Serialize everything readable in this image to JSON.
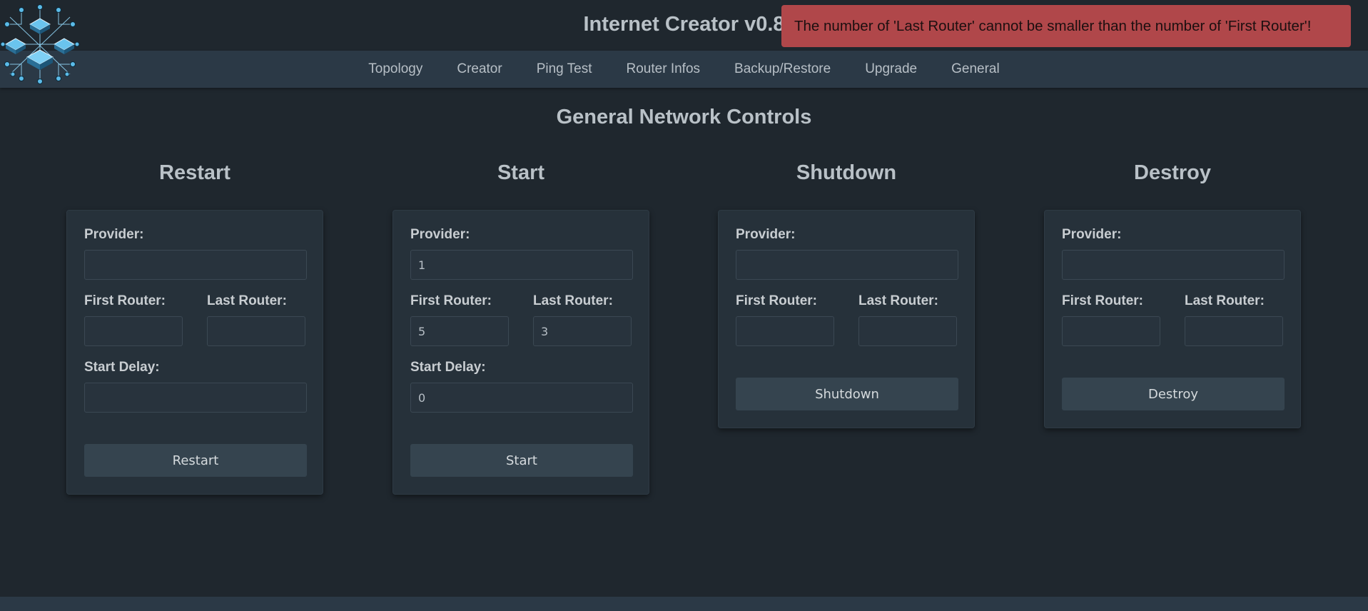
{
  "app": {
    "title": "Internet Creator v0.8"
  },
  "toast": {
    "message": "The number of 'Last Router' cannot be smaller than the number of 'First Router'!"
  },
  "nav": {
    "items": [
      "Topology",
      "Creator",
      "Ping Test",
      "Router Infos",
      "Backup/Restore",
      "Upgrade",
      "General"
    ]
  },
  "page": {
    "title": "General Network Controls"
  },
  "colors": {
    "background": "#1f272e",
    "navbar": "#2b3946",
    "card": "#26313a",
    "toast": "#b0474a",
    "button": "#35444f"
  },
  "labels": {
    "provider": "Provider:",
    "first_router": "First Router:",
    "last_router": "Last Router:",
    "start_delay": "Start Delay:"
  },
  "sections": {
    "restart": {
      "title": "Restart",
      "provider": "",
      "first_router": "",
      "last_router": "",
      "start_delay": "",
      "button": "Restart"
    },
    "start": {
      "title": "Start",
      "provider": "1",
      "first_router": "5",
      "last_router": "3",
      "start_delay": "0",
      "button": "Start"
    },
    "shutdown": {
      "title": "Shutdown",
      "provider": "",
      "first_router": "",
      "last_router": "",
      "button": "Shutdown"
    },
    "destroy": {
      "title": "Destroy",
      "provider": "",
      "first_router": "",
      "last_router": "",
      "button": "Destroy"
    }
  }
}
